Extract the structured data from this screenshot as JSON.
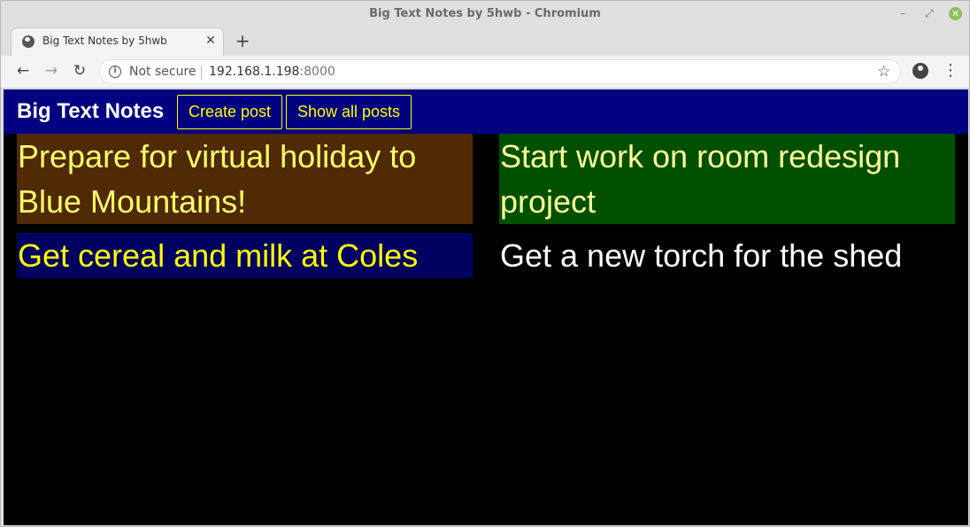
{
  "window": {
    "title": "Big Text Notes by 5hwb - Chromium",
    "minimize_glyph": "–",
    "maximize_glyph": "⤢",
    "close_glyph": "✕"
  },
  "tab": {
    "title": "Big Text Notes by 5hwb",
    "close_glyph": "✕",
    "new_tab_glyph": "+",
    "icon": "globe-icon"
  },
  "toolbar": {
    "back_glyph": "←",
    "forward_glyph": "→",
    "reload_glyph": "↻",
    "security_text": "Not secure",
    "url_host": "192.168.1.198",
    "url_port": ":8000",
    "star_glyph": "☆",
    "menu_glyph": "⋮"
  },
  "app": {
    "brand": "Big Text Notes",
    "nav": {
      "create_label": "Create post",
      "show_all_label": "Show all posts"
    },
    "colors": {
      "header_bg": "#000080",
      "nav_accent": "#ffff00",
      "page_bg": "#000000"
    }
  },
  "notes": [
    {
      "text": "Prepare for virtual holiday to Blue Mountains!",
      "bg": "#4f2a04",
      "fg": "#ffff66"
    },
    {
      "text": "Start work on room redesign project",
      "bg": "#005000",
      "fg": "#ffff99"
    },
    {
      "text": "Get cereal and milk at Coles",
      "bg": "#000060",
      "fg": "#ffff00"
    },
    {
      "text": "Get a new torch for the shed",
      "bg": "#000000",
      "fg": "#ffffff"
    }
  ]
}
